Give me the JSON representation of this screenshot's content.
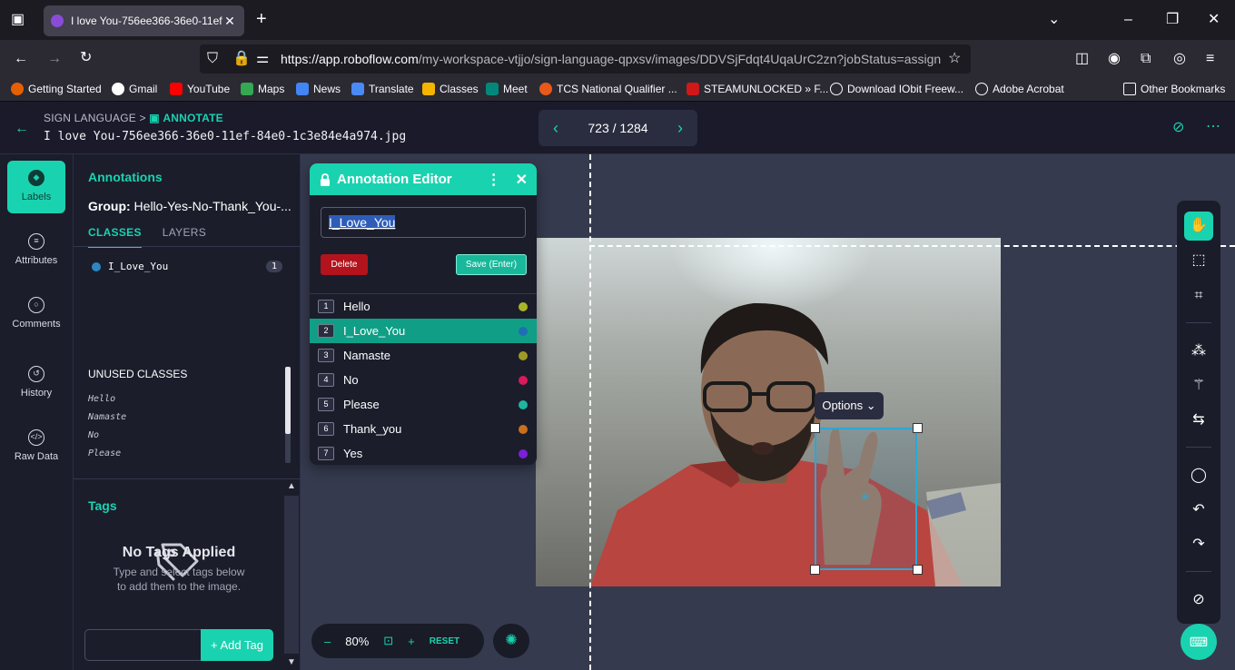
{
  "browser": {
    "tab_title": "I love You-756ee366-36e0-11ef-",
    "url_host": "https://app.roboflow.com",
    "url_path": "/my-workspace-vtjjo/sign-language-qpxsv/images/DDVSjFdqt4UqaUrC2zn?jobStatus=assign",
    "bookmarks": [
      "Getting Started",
      "Gmail",
      "YouTube",
      "Maps",
      "News",
      "Translate",
      "Classes",
      "Meet",
      "TCS National Qualifier ...",
      "STEAMUNLOCKED » F...",
      "Download IObit Freew...",
      "Adobe Acrobat"
    ],
    "other_bookmarks": "Other Bookmarks"
  },
  "header": {
    "crumb_parent": "SIGN LANGUAGE",
    "crumb_sep": ">",
    "crumb_active": "ANNOTATE",
    "filename": "I love You-756ee366-36e0-11ef-84e0-1c3e84e4a974.jpg",
    "pager": "723 / 1284"
  },
  "leftnav": [
    {
      "label": "Labels"
    },
    {
      "label": "Attributes"
    },
    {
      "label": "Comments"
    },
    {
      "label": "History"
    },
    {
      "label": "Raw Data"
    }
  ],
  "annotations": {
    "title": "Annotations",
    "group_label": "Group:",
    "group_value": "Hello-Yes-No-Thank_You-...",
    "tab_classes": "CLASSES",
    "tab_layers": "LAYERS",
    "class_name": "I_Love_You",
    "class_count": "1",
    "unused_title": "UNUSED CLASSES",
    "unused": [
      "Hello",
      "Namaste",
      "No",
      "Please"
    ],
    "tags_title": "Tags",
    "no_tags_title": "No Tags Applied",
    "no_tags_line1": "Type and select tags below",
    "no_tags_line2": "to add them to the image.",
    "add_tag": "+ Add Tag"
  },
  "editor": {
    "title": "Annotation Editor",
    "input_value": "I_Love_You",
    "delete": "Delete",
    "save": "Save (Enter)",
    "classes": [
      {
        "num": "1",
        "name": "Hello",
        "color": "#a8b52a"
      },
      {
        "num": "2",
        "name": "I_Love_You",
        "color": "#1e6fb5"
      },
      {
        "num": "3",
        "name": "Namaste",
        "color": "#9e9b24"
      },
      {
        "num": "4",
        "name": "No",
        "color": "#d81b5a"
      },
      {
        "num": "5",
        "name": "Please",
        "color": "#1fb5a0"
      },
      {
        "num": "6",
        "name": "Thank_you",
        "color": "#c8701c"
      },
      {
        "num": "7",
        "name": "Yes",
        "color": "#7b1fd8"
      }
    ]
  },
  "canvas": {
    "options": "Options",
    "zoom": "80%",
    "reset": "RESET"
  },
  "colors": {
    "accent": "#19d3b0",
    "bbox": "#2aa8d6",
    "delete": "#b3131c"
  }
}
